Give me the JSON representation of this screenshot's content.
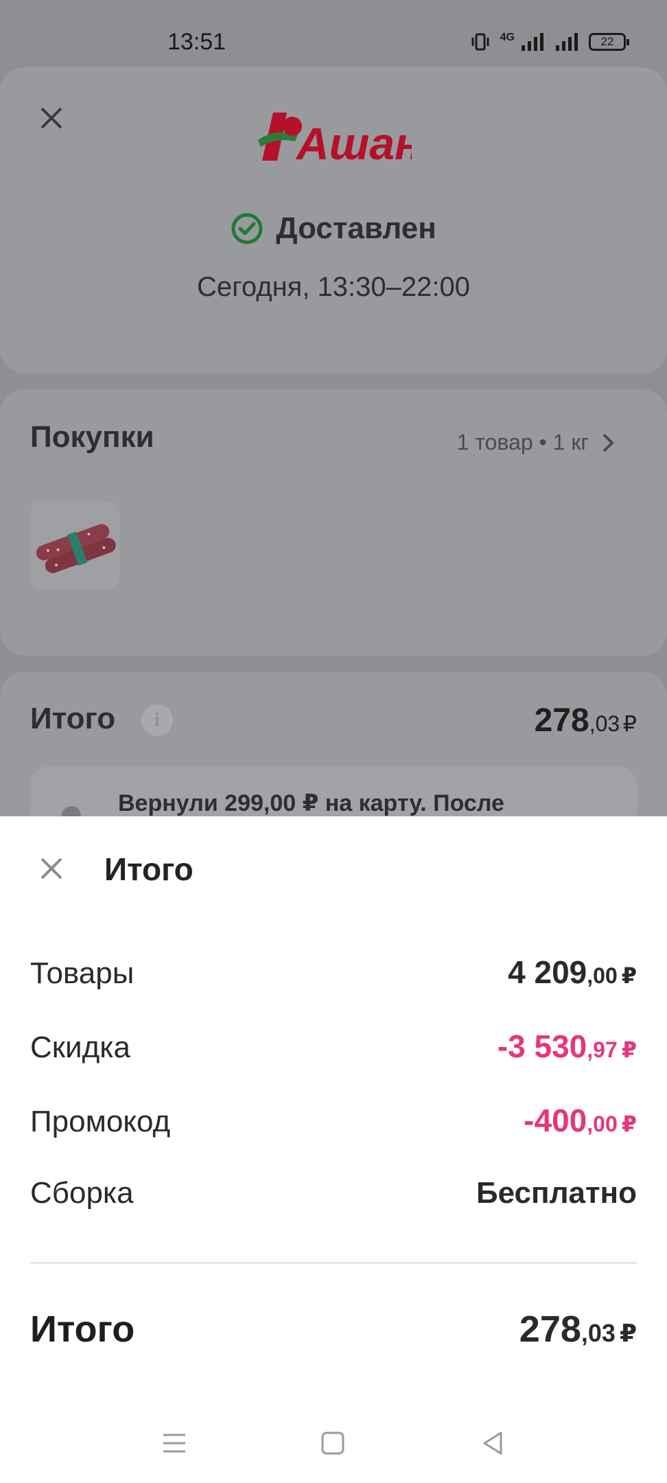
{
  "status_bar": {
    "time": "13:51",
    "network": "4G",
    "battery": "22"
  },
  "header": {
    "brand": "Ашан",
    "brand_color": "#c8102e",
    "order_status": "Доставлен",
    "status_color": "#1f7a35",
    "delivery_time": "Сегодня, 13:30–22:00"
  },
  "purchases": {
    "title": "Покупки",
    "meta": "1 товар • 1 кг"
  },
  "total_card": {
    "title": "Итого",
    "amount_int": "278",
    "amount_dec": ",03",
    "currency": "₽",
    "refund_text": "Вернули 299,00 ₽ на карту. После"
  },
  "sheet": {
    "title": "Итого",
    "rows": [
      {
        "label": "Товары",
        "int": "4 209",
        "dec": ",00",
        "currency": "₽"
      },
      {
        "label": "Скидка",
        "int": "-3 530",
        "dec": ",97",
        "currency": "₽"
      },
      {
        "label": "Промокод",
        "int": "-400",
        "dec": ",00",
        "currency": "₽"
      },
      {
        "label": "Сборка",
        "value": "Бесплатно"
      }
    ],
    "total": {
      "label": "Итого",
      "int": "278",
      "dec": ",03",
      "currency": "₽"
    },
    "discount_color": "#e6367b"
  }
}
